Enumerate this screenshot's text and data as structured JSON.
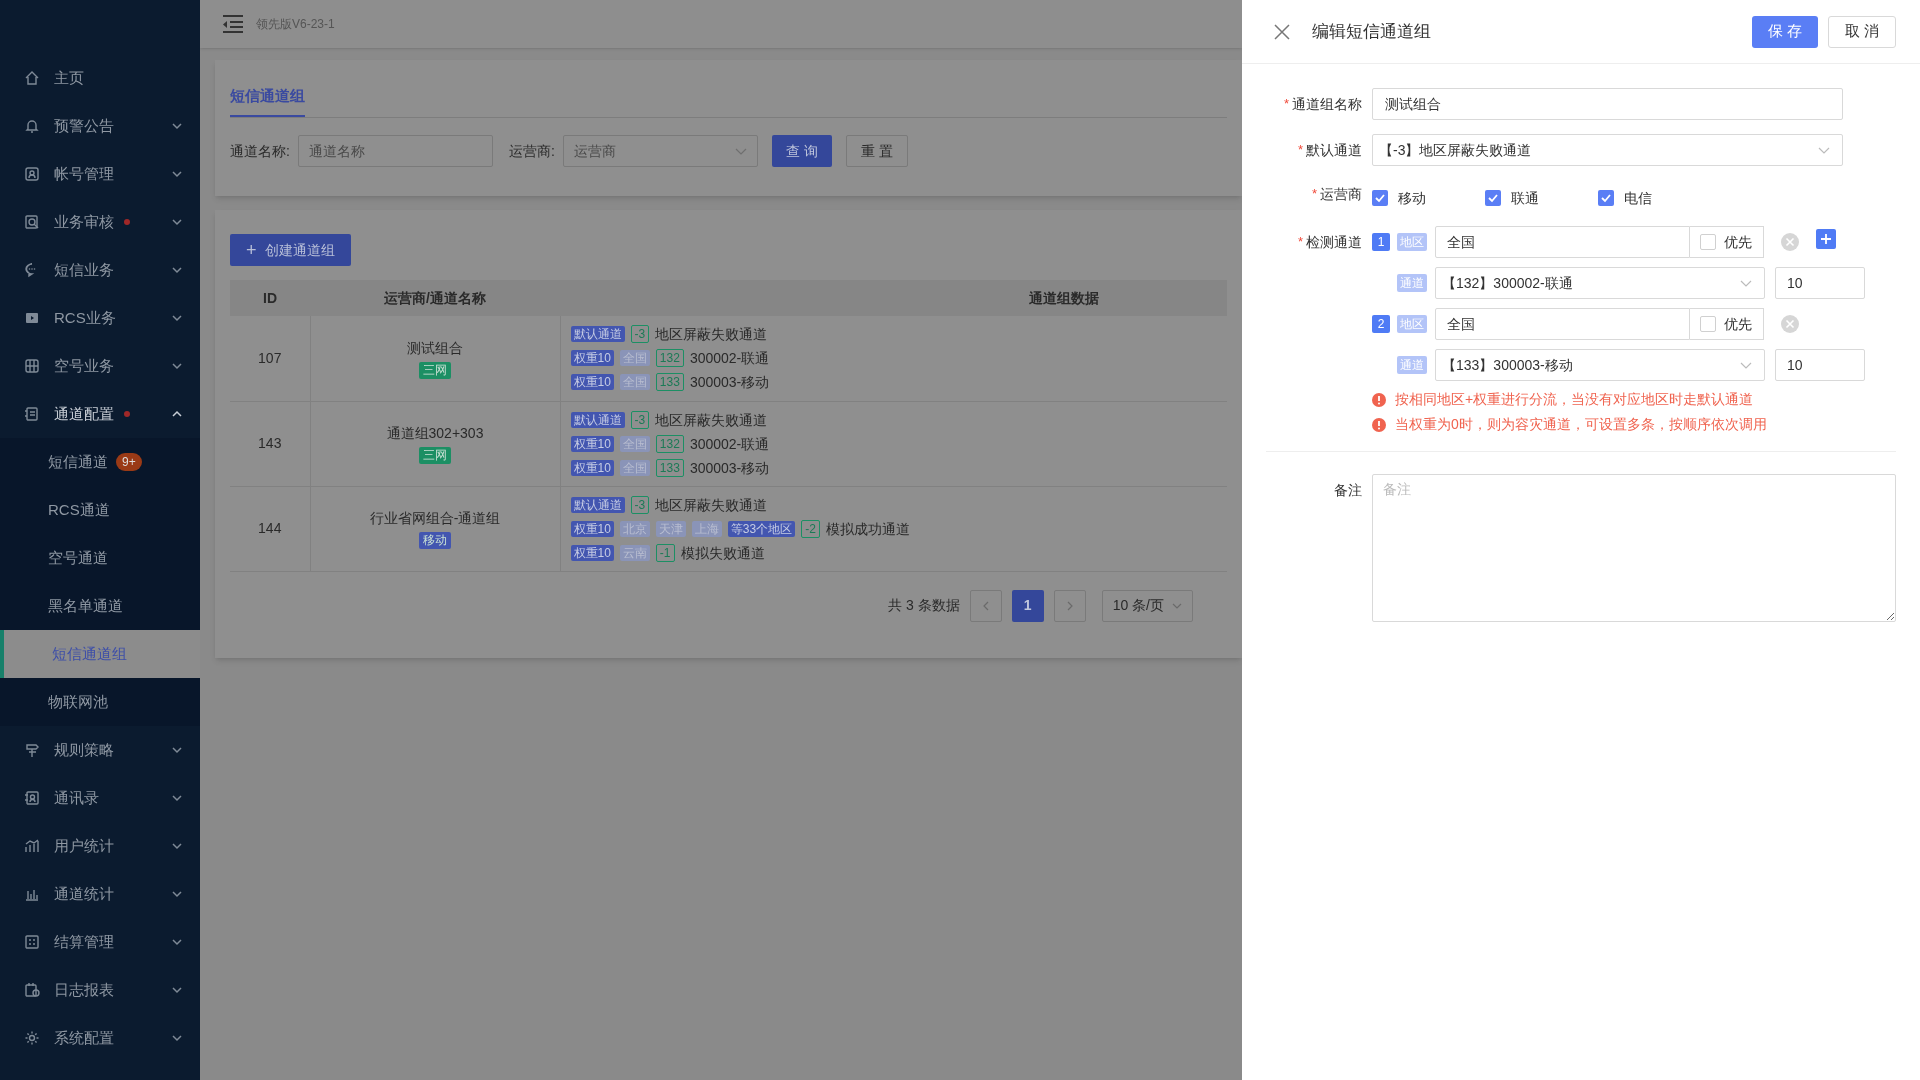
{
  "header": {
    "version": "领先版V6-23-1"
  },
  "sidebar": {
    "items": [
      {
        "label": "主页",
        "kind": "link",
        "alert": false
      },
      {
        "label": "预警公告",
        "kind": "group",
        "expanded": false,
        "alert": false
      },
      {
        "label": "帐号管理",
        "kind": "group",
        "expanded": false,
        "alert": false
      },
      {
        "label": "业务审核",
        "kind": "group",
        "expanded": false,
        "alert": true
      },
      {
        "label": "短信业务",
        "kind": "group",
        "expanded": false,
        "alert": false
      },
      {
        "label": "RCS业务",
        "kind": "group",
        "expanded": false,
        "alert": false
      },
      {
        "label": "空号业务",
        "kind": "group",
        "expanded": false,
        "alert": false
      },
      {
        "label": "通道配置",
        "kind": "group",
        "expanded": true,
        "alert": true,
        "children": [
          {
            "label": "短信通道",
            "selected": false,
            "badge": "9+"
          },
          {
            "label": "RCS通道",
            "selected": false
          },
          {
            "label": "空号通道",
            "selected": false
          },
          {
            "label": "黑名单通道",
            "selected": false
          },
          {
            "label": "短信通道组",
            "selected": true
          },
          {
            "label": "物联网池",
            "selected": false
          }
        ]
      },
      {
        "label": "规则策略",
        "kind": "group",
        "expanded": false,
        "alert": false
      },
      {
        "label": "通讯录",
        "kind": "group",
        "expanded": false,
        "alert": false
      },
      {
        "label": "用户统计",
        "kind": "group",
        "expanded": false,
        "alert": false
      },
      {
        "label": "通道统计",
        "kind": "group",
        "expanded": false,
        "alert": false
      },
      {
        "label": "结算管理",
        "kind": "group",
        "expanded": false,
        "alert": false
      },
      {
        "label": "日志报表",
        "kind": "group",
        "expanded": false,
        "alert": false
      },
      {
        "label": "系统配置",
        "kind": "group",
        "expanded": false,
        "alert": false
      }
    ]
  },
  "page": {
    "tabs": [
      {
        "label": "短信通道组",
        "selected": true
      }
    ],
    "filters": [
      {
        "label": "通道名称:",
        "placeholder": "通道名称",
        "kind": "input"
      },
      {
        "label": "运营商:",
        "placeholder": "运营商",
        "kind": "select"
      }
    ],
    "buttons": [
      {
        "label": "查 询",
        "kind": "primary"
      },
      {
        "label": "重 置",
        "kind": "default"
      }
    ],
    "create_button": {
      "icon": "+",
      "label": "创建通道组"
    },
    "table": {
      "columns": [
        "ID",
        "运营商/通道名称",
        "通道组数据"
      ],
      "rows": [
        {
          "id": "107",
          "name": "测试组合",
          "carrier": {
            "label": "三网",
            "color": "#1c8f64"
          },
          "lines": [
            [
              {
                "kind": "primary",
                "text": "默认通道"
              },
              {
                "kind": "code",
                "text": "-3"
              },
              {
                "kind": "text",
                "text": "地区屏蔽失败通道"
              }
            ],
            [
              {
                "kind": "primary",
                "text": "权重10"
              },
              {
                "kind": "muted",
                "text": "全国"
              },
              {
                "kind": "code",
                "text": "132"
              },
              {
                "kind": "text",
                "text": "300002-联通"
              }
            ],
            [
              {
                "kind": "primary",
                "text": "权重10"
              },
              {
                "kind": "muted",
                "text": "全国"
              },
              {
                "kind": "code",
                "text": "133"
              },
              {
                "kind": "text",
                "text": "300003-移动"
              }
            ]
          ]
        },
        {
          "id": "143",
          "name": "通道组302+303",
          "carrier": {
            "label": "三网",
            "color": "#1c8f64"
          },
          "lines": [
            [
              {
                "kind": "primary",
                "text": "默认通道"
              },
              {
                "kind": "code",
                "text": "-3"
              },
              {
                "kind": "text",
                "text": "地区屏蔽失败通道"
              }
            ],
            [
              {
                "kind": "primary",
                "text": "权重10"
              },
              {
                "kind": "muted",
                "text": "全国"
              },
              {
                "kind": "code",
                "text": "132"
              },
              {
                "kind": "text",
                "text": "300002-联通"
              }
            ],
            [
              {
                "kind": "primary",
                "text": "权重10"
              },
              {
                "kind": "muted",
                "text": "全国"
              },
              {
                "kind": "code",
                "text": "133"
              },
              {
                "kind": "text",
                "text": "300003-移动"
              }
            ]
          ]
        },
        {
          "id": "144",
          "name": "行业省网组合-通道组",
          "carrier": {
            "label": "移动",
            "color": "#4356b0"
          },
          "lines": [
            [
              {
                "kind": "primary",
                "text": "默认通道"
              },
              {
                "kind": "code",
                "text": "-3"
              },
              {
                "kind": "text",
                "text": "地区屏蔽失败通道"
              }
            ],
            [
              {
                "kind": "primary",
                "text": "权重10"
              },
              {
                "kind": "muted",
                "text": "北京"
              },
              {
                "kind": "muted",
                "text": "天津"
              },
              {
                "kind": "muted",
                "text": "上海"
              },
              {
                "kind": "primary",
                "text": "等33个地区"
              },
              {
                "kind": "code",
                "text": "-2"
              },
              {
                "kind": "text",
                "text": "模拟成功通道"
              }
            ],
            [
              {
                "kind": "primary",
                "text": "权重10"
              },
              {
                "kind": "muted",
                "text": "云南"
              },
              {
                "kind": "code",
                "text": "-1"
              },
              {
                "kind": "text",
                "text": "模拟失败通道"
              }
            ]
          ]
        }
      ]
    },
    "pagination": {
      "total": "共 3 条数据",
      "pages": [
        {
          "label": "1",
          "selected": true
        }
      ],
      "page_size": "10 条/页"
    }
  },
  "drawer": {
    "title": "编辑短信通道组",
    "buttons": [
      {
        "label": "保 存",
        "kind": "primary"
      },
      {
        "label": "取 消",
        "kind": "default"
      }
    ],
    "name": {
      "marker": "*",
      "label": "通道组名称",
      "value": "测试组合"
    },
    "default_channel": {
      "marker": "*",
      "label": "默认通道",
      "value": "【-3】地区屏蔽失败通道"
    },
    "carriers": {
      "marker": "*",
      "label": "运营商",
      "options": [
        {
          "label": "移动",
          "checked": true
        },
        {
          "label": "联通",
          "checked": true
        },
        {
          "label": "电信",
          "checked": true
        }
      ]
    },
    "detect": {
      "marker": "*",
      "label": "检测通道",
      "groups": [
        {
          "index": "1",
          "region_tag": "地区",
          "region": "全国",
          "priority": {
            "label": "优先",
            "checked": false
          },
          "addable": true,
          "channel_tag": "通道",
          "channel": "【132】300002-联通",
          "weight": "10"
        },
        {
          "index": "2",
          "region_tag": "地区",
          "region": "全国",
          "priority": {
            "label": "优先",
            "checked": false
          },
          "addable": false,
          "channel_tag": "通道",
          "channel": "【133】300003-移动",
          "weight": "10"
        }
      ]
    },
    "notes": [
      "按相同地区+权重进行分流，当没有对应地区时走默认通道",
      "当权重为0时，则为容灾通道，可设置多条，按顺序依次调用"
    ],
    "remarks": {
      "label": "备注",
      "placeholder": "备注"
    }
  }
}
